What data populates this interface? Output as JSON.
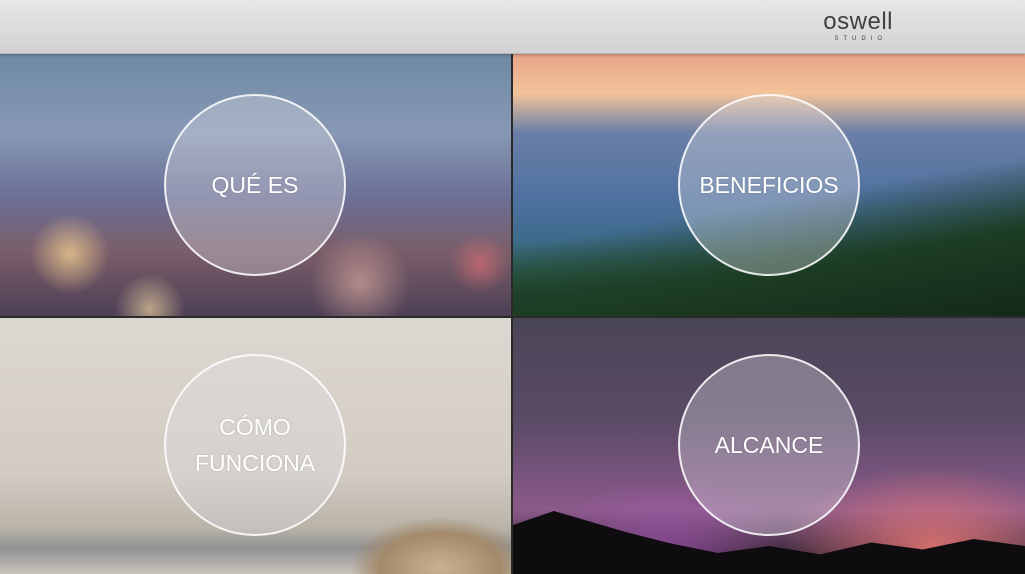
{
  "header": {
    "logo_main": "oswell",
    "logo_sub": "STUDIO"
  },
  "tiles": [
    {
      "label": "QUÉ ES"
    },
    {
      "label": "BENEFICIOS"
    },
    {
      "label_line1": "CÓMO",
      "label_line2": "FUNCIONA"
    },
    {
      "label": "ALCANCE"
    }
  ]
}
